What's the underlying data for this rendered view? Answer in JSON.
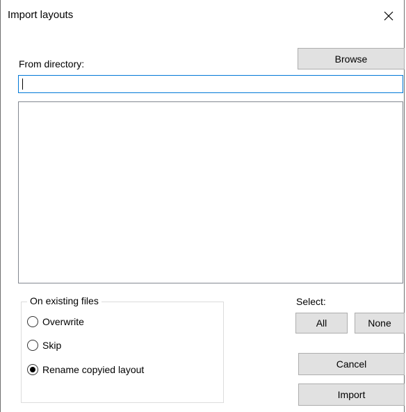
{
  "window": {
    "title": "Import layouts",
    "close_label": "×"
  },
  "directory": {
    "label": "From directory:",
    "value": "",
    "browse_label": "Browse"
  },
  "list": {
    "items": []
  },
  "existing_files": {
    "title": "On existing files",
    "options": [
      {
        "label": "Overwrite",
        "checked": false
      },
      {
        "label": "Skip",
        "checked": false
      },
      {
        "label": "Rename copyied layout",
        "checked": true
      }
    ]
  },
  "select": {
    "label": "Select:",
    "all_label": "All",
    "none_label": "None"
  },
  "actions": {
    "cancel_label": "Cancel",
    "import_label": "Import"
  }
}
